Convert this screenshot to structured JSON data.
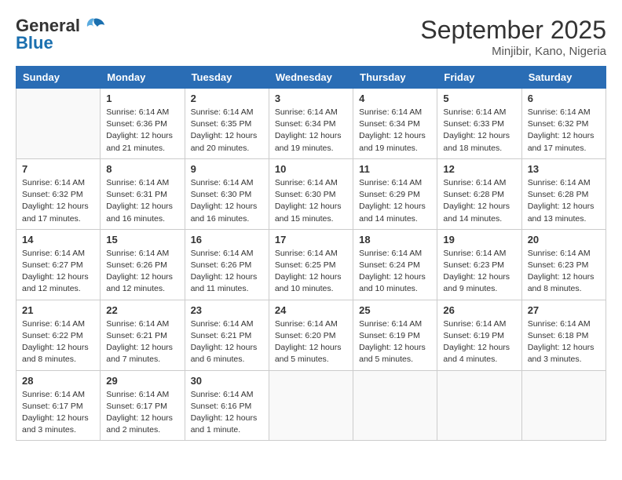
{
  "header": {
    "logo_general": "General",
    "logo_blue": "Blue",
    "month": "September 2025",
    "location": "Minjibir, Kano, Nigeria"
  },
  "weekdays": [
    "Sunday",
    "Monday",
    "Tuesday",
    "Wednesday",
    "Thursday",
    "Friday",
    "Saturday"
  ],
  "weeks": [
    [
      {
        "day": "",
        "info": ""
      },
      {
        "day": "1",
        "info": "Sunrise: 6:14 AM\nSunset: 6:36 PM\nDaylight: 12 hours\nand 21 minutes."
      },
      {
        "day": "2",
        "info": "Sunrise: 6:14 AM\nSunset: 6:35 PM\nDaylight: 12 hours\nand 20 minutes."
      },
      {
        "day": "3",
        "info": "Sunrise: 6:14 AM\nSunset: 6:34 PM\nDaylight: 12 hours\nand 19 minutes."
      },
      {
        "day": "4",
        "info": "Sunrise: 6:14 AM\nSunset: 6:34 PM\nDaylight: 12 hours\nand 19 minutes."
      },
      {
        "day": "5",
        "info": "Sunrise: 6:14 AM\nSunset: 6:33 PM\nDaylight: 12 hours\nand 18 minutes."
      },
      {
        "day": "6",
        "info": "Sunrise: 6:14 AM\nSunset: 6:32 PM\nDaylight: 12 hours\nand 17 minutes."
      }
    ],
    [
      {
        "day": "7",
        "info": "Sunrise: 6:14 AM\nSunset: 6:32 PM\nDaylight: 12 hours\nand 17 minutes."
      },
      {
        "day": "8",
        "info": "Sunrise: 6:14 AM\nSunset: 6:31 PM\nDaylight: 12 hours\nand 16 minutes."
      },
      {
        "day": "9",
        "info": "Sunrise: 6:14 AM\nSunset: 6:30 PM\nDaylight: 12 hours\nand 16 minutes."
      },
      {
        "day": "10",
        "info": "Sunrise: 6:14 AM\nSunset: 6:30 PM\nDaylight: 12 hours\nand 15 minutes."
      },
      {
        "day": "11",
        "info": "Sunrise: 6:14 AM\nSunset: 6:29 PM\nDaylight: 12 hours\nand 14 minutes."
      },
      {
        "day": "12",
        "info": "Sunrise: 6:14 AM\nSunset: 6:28 PM\nDaylight: 12 hours\nand 14 minutes."
      },
      {
        "day": "13",
        "info": "Sunrise: 6:14 AM\nSunset: 6:28 PM\nDaylight: 12 hours\nand 13 minutes."
      }
    ],
    [
      {
        "day": "14",
        "info": "Sunrise: 6:14 AM\nSunset: 6:27 PM\nDaylight: 12 hours\nand 12 minutes."
      },
      {
        "day": "15",
        "info": "Sunrise: 6:14 AM\nSunset: 6:26 PM\nDaylight: 12 hours\nand 12 minutes."
      },
      {
        "day": "16",
        "info": "Sunrise: 6:14 AM\nSunset: 6:26 PM\nDaylight: 12 hours\nand 11 minutes."
      },
      {
        "day": "17",
        "info": "Sunrise: 6:14 AM\nSunset: 6:25 PM\nDaylight: 12 hours\nand 10 minutes."
      },
      {
        "day": "18",
        "info": "Sunrise: 6:14 AM\nSunset: 6:24 PM\nDaylight: 12 hours\nand 10 minutes."
      },
      {
        "day": "19",
        "info": "Sunrise: 6:14 AM\nSunset: 6:23 PM\nDaylight: 12 hours\nand 9 minutes."
      },
      {
        "day": "20",
        "info": "Sunrise: 6:14 AM\nSunset: 6:23 PM\nDaylight: 12 hours\nand 8 minutes."
      }
    ],
    [
      {
        "day": "21",
        "info": "Sunrise: 6:14 AM\nSunset: 6:22 PM\nDaylight: 12 hours\nand 8 minutes."
      },
      {
        "day": "22",
        "info": "Sunrise: 6:14 AM\nSunset: 6:21 PM\nDaylight: 12 hours\nand 7 minutes."
      },
      {
        "day": "23",
        "info": "Sunrise: 6:14 AM\nSunset: 6:21 PM\nDaylight: 12 hours\nand 6 minutes."
      },
      {
        "day": "24",
        "info": "Sunrise: 6:14 AM\nSunset: 6:20 PM\nDaylight: 12 hours\nand 5 minutes."
      },
      {
        "day": "25",
        "info": "Sunrise: 6:14 AM\nSunset: 6:19 PM\nDaylight: 12 hours\nand 5 minutes."
      },
      {
        "day": "26",
        "info": "Sunrise: 6:14 AM\nSunset: 6:19 PM\nDaylight: 12 hours\nand 4 minutes."
      },
      {
        "day": "27",
        "info": "Sunrise: 6:14 AM\nSunset: 6:18 PM\nDaylight: 12 hours\nand 3 minutes."
      }
    ],
    [
      {
        "day": "28",
        "info": "Sunrise: 6:14 AM\nSunset: 6:17 PM\nDaylight: 12 hours\nand 3 minutes."
      },
      {
        "day": "29",
        "info": "Sunrise: 6:14 AM\nSunset: 6:17 PM\nDaylight: 12 hours\nand 2 minutes."
      },
      {
        "day": "30",
        "info": "Sunrise: 6:14 AM\nSunset: 6:16 PM\nDaylight: 12 hours\nand 1 minute."
      },
      {
        "day": "",
        "info": ""
      },
      {
        "day": "",
        "info": ""
      },
      {
        "day": "",
        "info": ""
      },
      {
        "day": "",
        "info": ""
      }
    ]
  ]
}
